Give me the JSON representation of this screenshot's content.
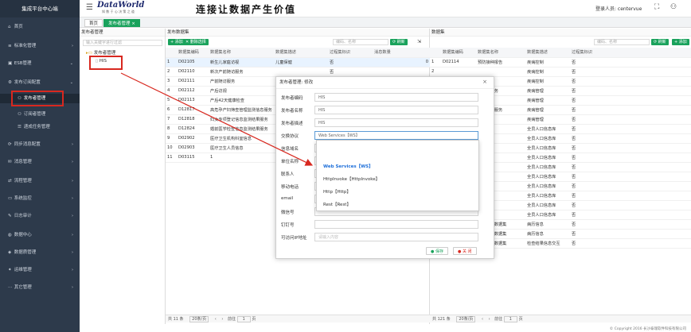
{
  "sidebar": {
    "brand": "集成平台中心端",
    "items": [
      {
        "label": "首页",
        "icon": "home-icon"
      },
      {
        "label": "标准化管理",
        "icon": "list-icon"
      },
      {
        "label": "ESB管理",
        "icon": "server-icon"
      },
      {
        "label": "发布订阅配置",
        "icon": "gear-icon"
      },
      {
        "label": "发布者管理",
        "icon": "user-icon"
      },
      {
        "label": "订阅者管理",
        "icon": "user-icon"
      },
      {
        "label": "递成任务管理",
        "icon": "task-icon"
      },
      {
        "label": "同步消息配置",
        "icon": "sync-icon"
      },
      {
        "label": "消息管理",
        "icon": "message-icon"
      },
      {
        "label": "流程管理",
        "icon": "flow-icon"
      },
      {
        "label": "系统监控",
        "icon": "monitor-icon"
      },
      {
        "label": "日志审计",
        "icon": "log-icon"
      },
      {
        "label": "数据中心",
        "icon": "database-icon"
      },
      {
        "label": "数据质管理",
        "icon": "quality-icon"
      },
      {
        "label": "运维管理",
        "icon": "tools-icon"
      },
      {
        "label": "其它管理",
        "icon": "more-icon"
      }
    ]
  },
  "header": {
    "logo_title": "DataWorld",
    "logo_sub": "知 数 于 心 决 策 之 道",
    "slogan": "连接让数据产生价值",
    "login_label": "登录人员: centervue"
  },
  "tabs": [
    {
      "label": "首页"
    },
    {
      "label": "发布者管理 ×"
    }
  ],
  "left_panel": {
    "title": "发布者管理",
    "search_placeholder": "输入关键字进行过滤",
    "tree_root": "发布者管理",
    "tree_child": "HIS"
  },
  "mid_panel": {
    "title": "发布数据集",
    "add_label": "添加",
    "delete_label": "删除选择",
    "search_placeholder": "编码、名称",
    "refresh_label": "刷新",
    "columns": [
      "",
      "数据集编码",
      "数据集名称",
      "数据集描述",
      "过程集标识",
      "消息数量"
    ],
    "rows": [
      [
        "1",
        "D02105",
        "新生儿家庭访视",
        "儿童保健",
        "否",
        "0"
      ],
      [
        "2",
        "D02110",
        "新次产前随访服务",
        "",
        "否",
        ""
      ],
      [
        "3",
        "D02111",
        "产前随访服务",
        "",
        "",
        ""
      ],
      [
        "4",
        "D02112",
        "产后访视",
        "",
        "",
        ""
      ],
      [
        "5",
        "D02113",
        "产后42天健康检查",
        "",
        "",
        ""
      ],
      [
        "6",
        "D12817",
        "高危孕产妇筛查管理监测信息服务",
        "",
        "",
        ""
      ],
      [
        "7",
        "D12818",
        "妇女专项登记信息监测结果服务",
        "",
        "",
        ""
      ],
      [
        "8",
        "D12824",
        "婚前医学检查信息监测结果服务",
        "",
        "",
        ""
      ],
      [
        "9",
        "D02902",
        "医疗卫生机构科室信息",
        "",
        "",
        ""
      ],
      [
        "10",
        "D02903",
        "医疗卫生人员信息",
        "",
        "",
        ""
      ],
      [
        "11",
        "D03115",
        "1",
        "",
        "",
        ""
      ]
    ],
    "pager_total": "共 11 条",
    "pager_size": "20条/页",
    "pager_goto": "前往",
    "pager_page": "1",
    "pager_unit": "页"
  },
  "right_panel": {
    "title": "数据集",
    "search_placeholder": "编码、名称",
    "refresh_label": "刷新",
    "add_label": "添加",
    "columns": [
      "",
      "数据集编码",
      "数据集名称",
      "数据集描述",
      "过程集标识"
    ],
    "rows": [
      [
        "1",
        "D02114",
        "预防接种报告",
        "疾病控制",
        "否"
      ],
      [
        "2",
        "",
        "",
        "疾病控制",
        "否"
      ],
      [
        "3",
        "",
        "记录",
        "疾病控制",
        "否"
      ],
      [
        "4",
        "",
        "者随访服务",
        "疾病管理",
        "否"
      ],
      [
        "5",
        "",
        "",
        "疾病管理",
        "否"
      ],
      [
        "6",
        "",
        "病者随访服务",
        "疾病管理",
        "否"
      ],
      [
        "7",
        "",
        "",
        "疾病管理",
        "否"
      ],
      [
        "8",
        "",
        "",
        "全员人口信息库",
        "否"
      ],
      [
        "9",
        "",
        "",
        "全员人口信息库",
        "否"
      ],
      [
        "10",
        "",
        "",
        "全员人口信息库",
        "否"
      ],
      [
        "11",
        "",
        "",
        "全员人口信息库",
        "否"
      ],
      [
        "12",
        "",
        "申请",
        "全员人口信息库",
        "否"
      ],
      [
        "13",
        "",
        "",
        "全员人口信息库",
        "否"
      ],
      [
        "14",
        "",
        "",
        "全员人口信息库",
        "否"
      ],
      [
        "15",
        "",
        "",
        "全员人口信息库",
        "否"
      ],
      [
        "16",
        "",
        "",
        "全员人口信息库",
        "否"
      ],
      [
        "17",
        "",
        "",
        "全员人口信息库",
        "否"
      ],
      [
        "18",
        "D02835",
        "门诊摘要数据集",
        "病历信息",
        "否"
      ],
      [
        "19",
        "D02836",
        "住院摘要数据集",
        "病历信息",
        "否"
      ],
      [
        "20",
        "D02829",
        "急救调度数据集",
        "检查结果信息交互",
        "否"
      ]
    ],
    "pager_total": "共 121 条",
    "pager_size": "20条/页",
    "pager_goto": "前往",
    "pager_page": "1",
    "pager_unit": "页"
  },
  "modal": {
    "title": "发布者管理: 修改",
    "fields": [
      {
        "label": "发布者编码",
        "value": "HIS"
      },
      {
        "label": "发布者名称",
        "value": "HIS"
      },
      {
        "label": "发布者描述",
        "value": "HIS"
      },
      {
        "label": "交换协议",
        "value": "Web Services【WS】"
      },
      {
        "label": "信息域名",
        "value": ""
      },
      {
        "label": "单位名称",
        "value": ""
      },
      {
        "label": "联系人",
        "value": ""
      },
      {
        "label": "移动电话",
        "value": ""
      },
      {
        "label": "email",
        "value": ""
      },
      {
        "label": "微信号",
        "value": ""
      },
      {
        "label": "钉钉号",
        "value": ""
      },
      {
        "label": "可访问IP地址",
        "value": ""
      }
    ],
    "ip_placeholder": "请输入内容",
    "save_label": "保存",
    "close_label": "关 闭"
  },
  "dropdown": {
    "options": [
      {
        "label": "Web Services【WS】",
        "active": true
      },
      {
        "label": "HttpInvoke【HttpInvoke】",
        "active": false
      },
      {
        "label": "Http【Http】",
        "active": false
      },
      {
        "label": "Rest【Rest】",
        "active": false
      }
    ]
  },
  "footer": {
    "copyright": "© Copyright 2016 长沙泰瑞软件科技有限公司"
  },
  "colors": {
    "sidebar_bg": "#2d3a4b",
    "accent_green": "#1aa25c",
    "highlight_red": "#d8281f",
    "dropdown_active": "#1e6fd9"
  }
}
